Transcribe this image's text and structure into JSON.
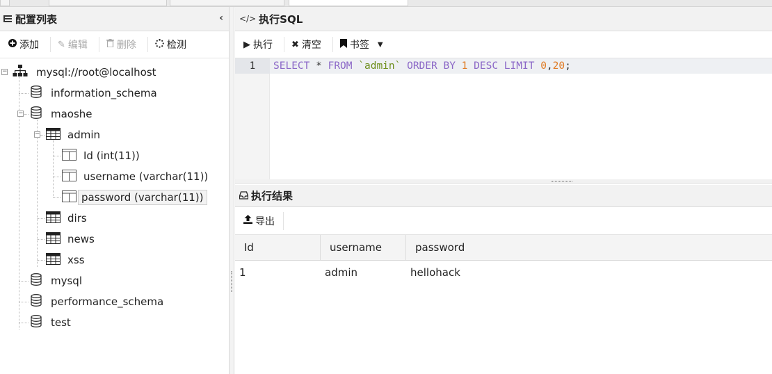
{
  "left_panel": {
    "title": "配置列表",
    "collapse_glyph": "‹",
    "toolbar": {
      "add": "添加",
      "edit": "编辑",
      "delete": "删除",
      "check": "检测"
    },
    "tree": {
      "connection": "mysql://root@localhost",
      "databases": [
        "information_schema",
        "maoshe",
        "mysql",
        "performance_schema",
        "test"
      ],
      "maoshe_tables": [
        "admin",
        "dirs",
        "news",
        "xss"
      ],
      "admin_columns": [
        "Id (int(11))",
        "username (varchar(11))",
        "password (varchar(11))"
      ],
      "selected": "password (varchar(11))"
    }
  },
  "sql_panel": {
    "title": "执行SQL",
    "toolbar": {
      "execute": "执行",
      "clear": "清空",
      "bookmark": "书签"
    },
    "editor": {
      "line_number": "1",
      "tokens": {
        "t1": "SELECT",
        "t2": " * ",
        "t3": "FROM",
        "t4": " ",
        "t5": "`admin`",
        "t6": " ",
        "t7": "ORDER BY",
        "t8": " ",
        "t9": "1",
        "t10": " ",
        "t11": "DESC LIMIT",
        "t12": " ",
        "t13": "0",
        "t14": ",",
        "t15": "20",
        "t16": ";"
      }
    }
  },
  "result_panel": {
    "title": "执行结果",
    "export": "导出",
    "columns": [
      "Id",
      "username",
      "password"
    ],
    "rows": [
      [
        "1",
        "admin",
        "hellohack"
      ]
    ]
  },
  "colors": {
    "keyword": "#8b67c7",
    "string": "#6e8f1c",
    "number": "#e07a22"
  }
}
